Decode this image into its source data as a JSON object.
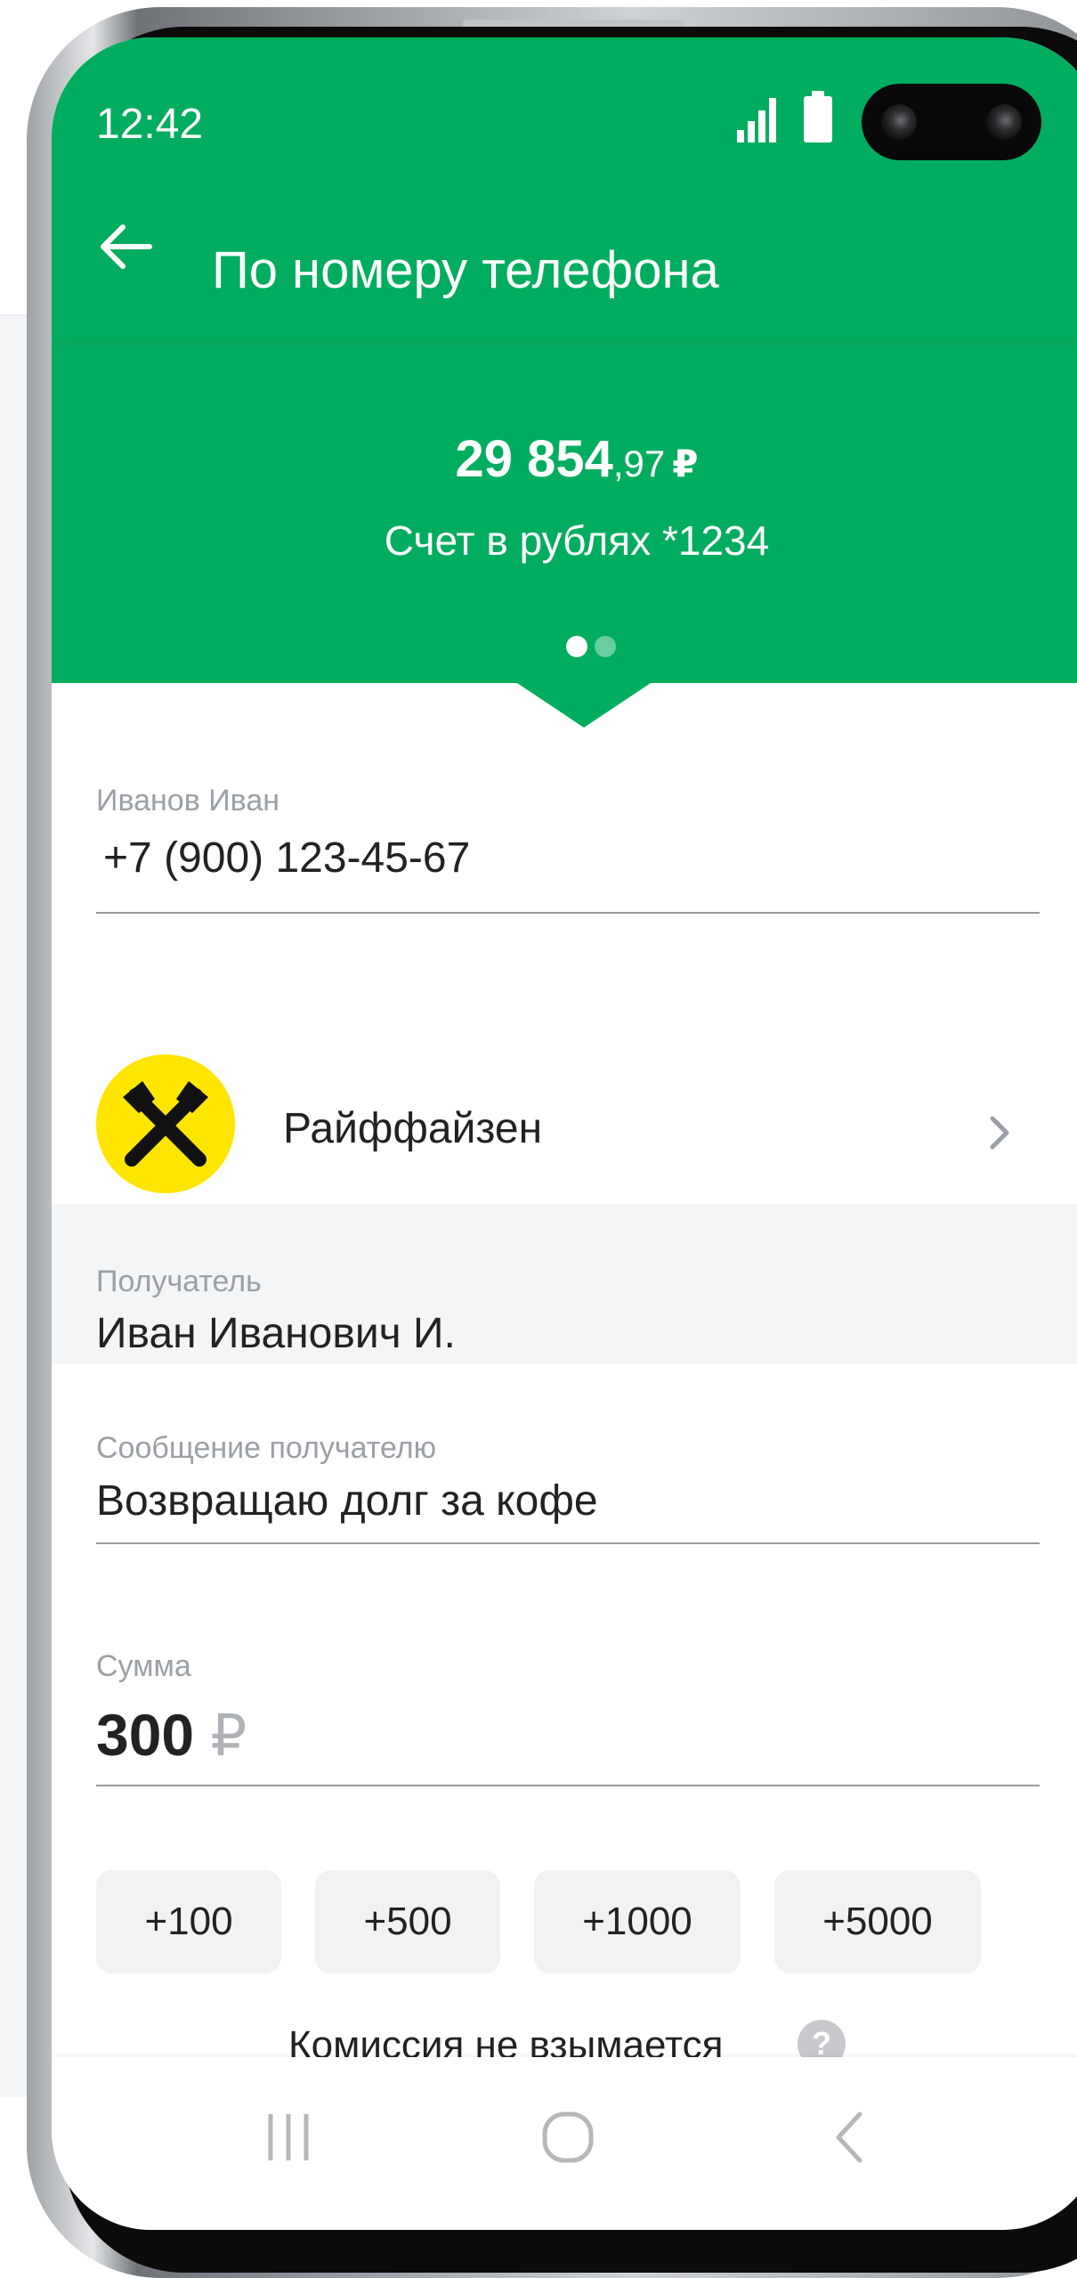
{
  "status_bar": {
    "time": "12:42"
  },
  "header": {
    "title": "По номеру телефона"
  },
  "account_card": {
    "balance_main": "29 854",
    "balance_cents": ",97",
    "currency_symbol": "₽",
    "account_name": "Счет в рублях *1234",
    "pager_pages": 2,
    "pager_active": 1
  },
  "form": {
    "contact_name": "Иванов Иван",
    "phone": "+7 (900) 123-45-67",
    "bank_name": "Райффайзен",
    "bank_logo_color": "#fee600",
    "recipient_label": "Получатель",
    "recipient_name": "Иван Иванович И.",
    "message_label": "Сообщение получателю",
    "message_value": "Возвращаю долг за кофе",
    "amount_label": "Сумма",
    "amount_value": "300",
    "amount_currency": "₽"
  },
  "quick_amounts": [
    "+100",
    "+500",
    "+1000",
    "+5000"
  ],
  "fee_note": "Комиссия не взымается",
  "colors": {
    "brand_green": "#00ad5f",
    "text": "#222222",
    "hint": "#9aa0a6"
  },
  "icons": {
    "back": "arrow-left-icon",
    "bank_logo": "raiffeisen-logo",
    "chevron": "chevron-right-icon",
    "help": "question-icon",
    "nav": [
      "recents-icon",
      "home-icon",
      "back-icon"
    ]
  }
}
